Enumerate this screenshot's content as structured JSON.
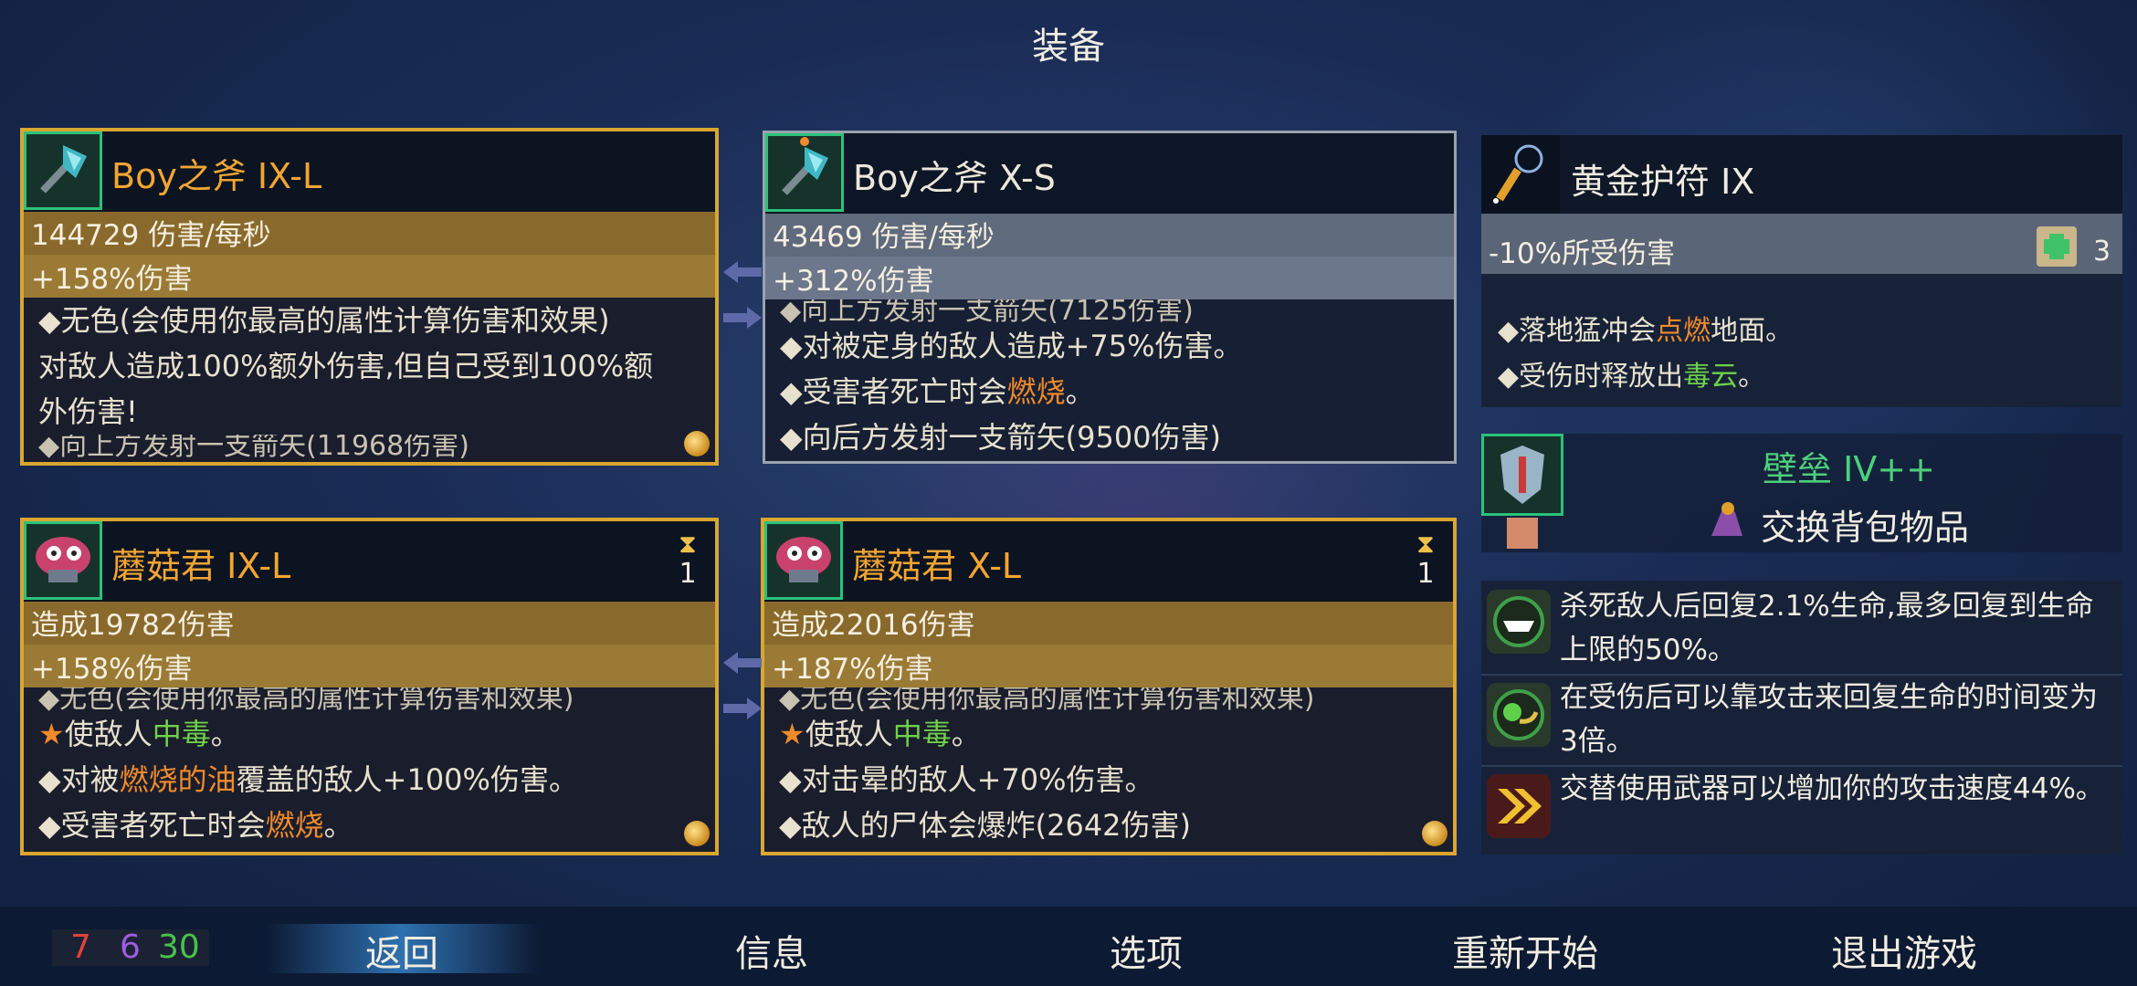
{
  "title": "装备",
  "weapons": {
    "w1": {
      "name": "Boy之斧 IX-L",
      "stat1": "144729 伤害/每秒",
      "stat2": "+158%伤害",
      "lines": [
        "◆无色(会使用你最高的属性计算伤害和效果)",
        "对敌人造成100%额外伤害,但自己受到100%额",
        "外伤害!",
        "◆向上方发射一支箭矢(11968伤害)"
      ]
    },
    "w2": {
      "name": "Boy之斧 X-S",
      "stat1": "43469 伤害/每秒",
      "stat2": "+312%伤害",
      "lines": [
        "◆向上方发射一支箭矢(7125伤害)",
        "◆对被定身的敌人造成+75%伤害。",
        "◆受害者死亡时会",
        "燃烧",
        "。",
        "◆向后方发射一支箭矢(9500伤害)"
      ]
    },
    "w3": {
      "name": "蘑菇君 IX-L",
      "timer": "1",
      "stat1": "造成19782伤害",
      "stat2": "+158%伤害",
      "lines": [
        "◆无色(会使用你最高的属性计算伤害和效果)",
        "使敌人",
        "中毒",
        "。",
        "◆对被",
        "燃烧的油",
        "覆盖的敌人+100%伤害。",
        "◆受害者死亡时会",
        "燃烧",
        "。"
      ]
    },
    "w4": {
      "name": "蘑菇君 X-L",
      "timer": "1",
      "stat1": "造成22016伤害",
      "stat2": "+187%伤害",
      "lines": [
        "◆无色(会使用你最高的属性计算伤害和效果)",
        "使敌人",
        "中毒",
        "。",
        "◆对击晕的敌人+70%伤害。",
        "◆敌人的尸体会爆炸(2642伤害)"
      ]
    }
  },
  "amulet": {
    "name": "黄金护符 IX",
    "stat": "-10%所受伤害",
    "scroll_count": "3",
    "lines": [
      "◆落地猛冲会",
      "点燃",
      "地面。",
      "◆受伤时释放出",
      "毒云",
      "。"
    ]
  },
  "shield": {
    "name": "壁垒 IV++",
    "swap_label": "交换背包物品"
  },
  "mutations": [
    {
      "icon": "fang-mouth-icon",
      "text": "杀死敌人后回复2.1%生命,最多回复到生命上限的50%。"
    },
    {
      "icon": "snake-eye-icon",
      "text": "在受伤后可以靠攻击来回复生命的时间变为3倍。"
    },
    {
      "icon": "double-chevron-icon",
      "text": "交替使用武器可以增加你的攻击速度44%。"
    }
  ],
  "scrolls": {
    "red": "7",
    "purple": "6",
    "green": "30"
  },
  "menu": {
    "back": "返回",
    "info": "信息",
    "options": "选项",
    "restart": "重新开始",
    "quit": "退出游戏"
  },
  "colors": {
    "gold_border": "#d9a630",
    "name_orange": "#f2a531",
    "poison_green": "#6fd04a",
    "burn_orange": "#f08a2a",
    "shield_green": "#4cd07a"
  }
}
